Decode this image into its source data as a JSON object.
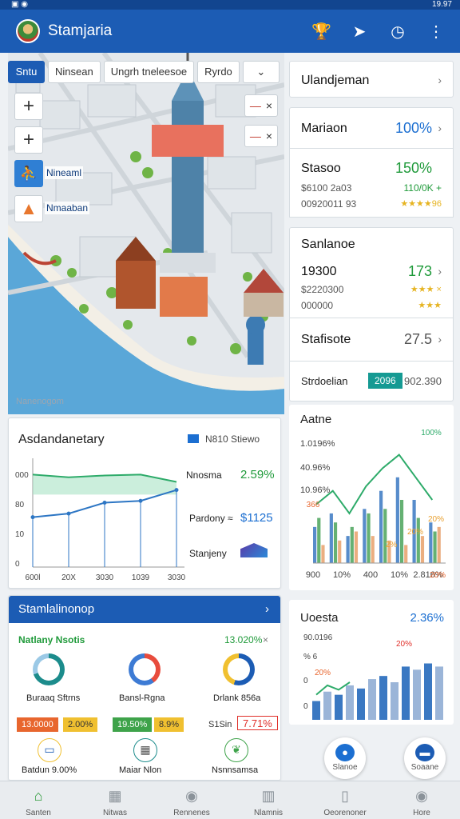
{
  "status_bar": {
    "left_icons": "▣ ◉",
    "time": "19.97"
  },
  "app": {
    "title": "Stamjaria"
  },
  "appbar_icons": [
    "trophy-icon",
    "navigate-icon",
    "clock-icon",
    "more-vert-icon"
  ],
  "map": {
    "tabs": [
      "Sntu",
      "Ninsean",
      "Ungrh tneleesoe",
      "Ryrdo",
      "⌄"
    ],
    "zoom_in": "+",
    "zoom_out": "+",
    "label_1": "Nineaml",
    "label_2": "Nmaaban",
    "mini_1": "×",
    "mini_2": "×",
    "watermark": "Nanenogom"
  },
  "right_panel": {
    "header": "Ulandjeman",
    "row1": {
      "label": "Mariaon",
      "value": "100%"
    },
    "row2": {
      "label": "Stasoo",
      "value": "150%",
      "sub": "$6100 2a03",
      "sub_value": "110/0K +",
      "sub2": "00920011 93",
      "stars": "★★★★96"
    },
    "row3": {
      "label": "Sanlanoe",
      "label2": "19300",
      "value": "173",
      "sub": "$2220300",
      "stars1": "★★★ ×",
      "sub2": "000000",
      "stars2": "★★★"
    },
    "row4": {
      "label": "Stafisote",
      "value": "27.5"
    },
    "row5": {
      "label": "Strdoelian",
      "badge": "2096",
      "value": "902.390"
    }
  },
  "left_chart": {
    "title": "Asdandanetary",
    "legend": "N810 Stiewo",
    "yticks": [
      "000",
      "80",
      "10",
      "0"
    ],
    "xticks": [
      "600l",
      "20X",
      "3030",
      "1039",
      "3030"
    ],
    "items": [
      {
        "label": "Nnosma",
        "value": "2.59%"
      },
      {
        "label": "Pardony ≈",
        "value": "$1125"
      },
      {
        "label": "Stanjeny"
      }
    ]
  },
  "chart_data": [
    {
      "type": "line",
      "title": "Asdandanetary",
      "x": [
        "600l",
        "20X",
        "3030",
        "1039",
        "3030"
      ],
      "series": [
        {
          "name": "",
          "values": [
            102,
            99,
            101,
            102,
            94
          ]
        },
        {
          "name": "",
          "values": [
            55,
            59,
            71,
            73,
            85
          ]
        }
      ],
      "ylim": [
        0,
        120
      ]
    },
    {
      "type": "bar",
      "title": "Aatne",
      "categories": [
        "1",
        "2",
        "3",
        "4",
        "5",
        "6",
        "7",
        "8"
      ],
      "series": [
        {
          "name": "blue",
          "values": [
            40,
            55,
            30,
            60,
            80,
            95,
            70,
            45
          ]
        },
        {
          "name": "green",
          "values": [
            50,
            45,
            40,
            55,
            60,
            70,
            50,
            35
          ]
        },
        {
          "name": "orange",
          "values": [
            20,
            25,
            35,
            30,
            25,
            20,
            30,
            40
          ]
        }
      ],
      "ylim": [
        0,
        140
      ]
    },
    {
      "type": "bar",
      "title": "Uoesta",
      "categories": [
        "1",
        "2",
        "3",
        "4",
        "5",
        "6",
        "7",
        "8",
        "9",
        "10",
        "11",
        "12"
      ],
      "series": [
        {
          "name": "blue",
          "values": [
            30,
            45,
            40,
            55,
            50,
            65,
            70,
            60,
            85,
            80,
            90,
            85
          ]
        }
      ],
      "ylim": [
        0,
        120
      ]
    }
  ],
  "mid_chart": {
    "title": "Aatne",
    "yticks": [
      "1.0196%",
      "40.96%",
      "10.96%"
    ],
    "xticks": [
      "900",
      "10%",
      "400",
      "10%",
      "2.816%"
    ],
    "annotations": [
      "100%",
      "366",
      "20%",
      "20%",
      "2%",
      "20%"
    ]
  },
  "br_chart": {
    "title": "Uoesta",
    "value": "2.36%",
    "yticks": [
      "90.0196",
      "% 6",
      "0",
      "0"
    ],
    "annotations": [
      "20%",
      "20%"
    ]
  },
  "bottom_left": {
    "header": "Stamlalinonop",
    "sub_label": "Natlany Nsotis",
    "sub_value": "13.020%",
    "donuts": [
      "Buraaq Sftrns",
      "Bansl-Rgna",
      "Drlank 856a"
    ],
    "tags": [
      {
        "text": "13.0000",
        "color": "#e8662e"
      },
      {
        "text": "2.00%",
        "color": "#f0c030"
      },
      {
        "text": "19.50%",
        "color": "#3ea34a"
      },
      {
        "text": "8.9%",
        "color": "#f0c030"
      },
      {
        "text": "S1Sin",
        "color": "#ffffff"
      },
      {
        "text": "7.71%",
        "color": "#ffffff"
      }
    ],
    "icons": [
      "Batdun 9.00%",
      "Maiar Nlon",
      "Nsnnsamsa"
    ]
  },
  "fabs": [
    {
      "label": "Slanoe"
    },
    {
      "label": "Soaane"
    }
  ],
  "navbar": [
    "Santen",
    "Nitwas",
    "Rennenes",
    "Nlamnis",
    "Oeorenoner",
    "Hore"
  ]
}
